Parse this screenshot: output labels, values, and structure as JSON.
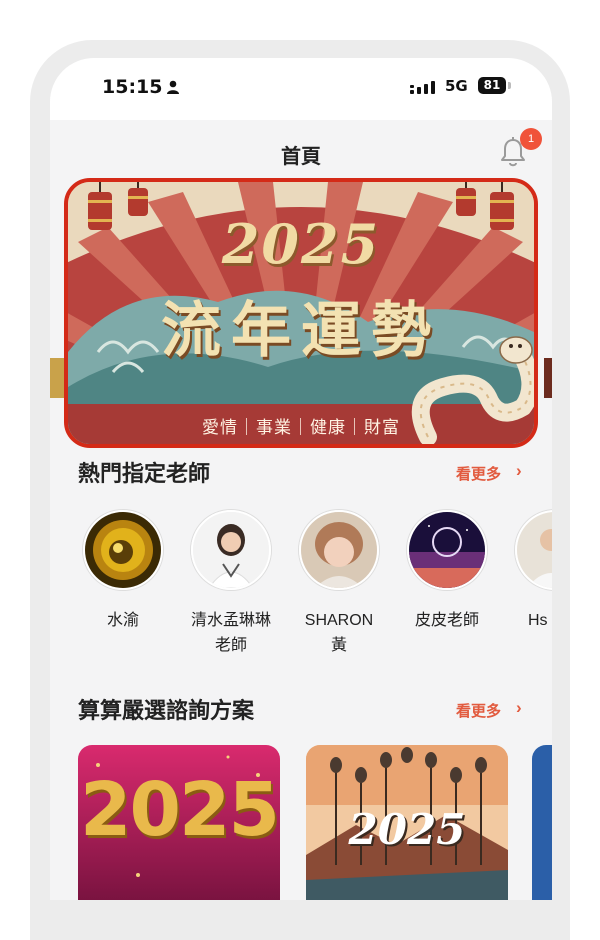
{
  "status_bar": {
    "time": "15:15",
    "network": "5G",
    "battery": "81"
  },
  "header": {
    "title": "首頁",
    "notification_count": "1"
  },
  "banner": {
    "year": "2025",
    "title": "流年運勢",
    "tags": "愛情｜事業｜健康｜財富"
  },
  "teachers_section": {
    "title": "熱門指定老師",
    "more": "看更多",
    "items": [
      {
        "name": "水渝"
      },
      {
        "name": "清水孟琳琳\n老師"
      },
      {
        "name": "SHARON\n黃"
      },
      {
        "name": "皮皮老師"
      },
      {
        "name": "Hs"
      }
    ]
  },
  "plans_section": {
    "title": "算算嚴選諮詢方案",
    "more": "看更多",
    "cards": [
      {
        "label": "2025"
      },
      {
        "label": "2025"
      }
    ]
  }
}
